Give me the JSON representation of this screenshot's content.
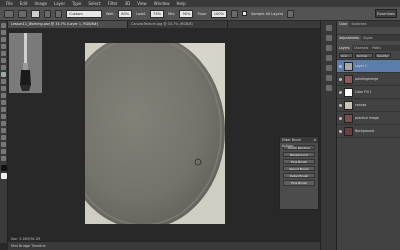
{
  "menubar": {
    "items": [
      "File",
      "Edit",
      "Image",
      "Layer",
      "Type",
      "Select",
      "Filter",
      "3D",
      "View",
      "Window",
      "Help"
    ]
  },
  "options": {
    "mode_value": "Custom",
    "wet_value": "80%",
    "load_value": "75%",
    "mix_value": "90%",
    "flow_value": "100%",
    "sample_label": "Sample All Layers"
  },
  "workspace_label": "Essentials",
  "tabs": [
    {
      "label": "Lesson11_Working.psd @ 33.7% (Layer 1, RGB/8#)",
      "active": true
    },
    {
      "label": "CanvasTexture.jpg @ 33.7% (RGB/8)",
      "active": false
    }
  ],
  "doc_info": "Doc: 5.28M/36.1M",
  "status": "Mini Bridge   Timeline",
  "actions_panel": {
    "title": "Mixer Brush Actions",
    "rows": [
      "Photo Painting",
      "Background",
      "Fine Brush",
      "Round Brush",
      "Detail Brush",
      "Fine Brush"
    ]
  },
  "panels": {
    "top_tabs": [
      "Color",
      "Swatches"
    ],
    "adj_tabs": [
      "Adjustments",
      "Styles"
    ],
    "layer_tabs": [
      "Layers",
      "Channels",
      "Paths"
    ],
    "kind_label": "Kind",
    "blend_label": "Normal",
    "opacity_label": "Opacity:",
    "layers": [
      {
        "name": "Layer 1",
        "active": true,
        "thumb": "#a8a8a8"
      },
      {
        "name": "paintingmerge",
        "active": false,
        "thumb": "#8a5c5c"
      },
      {
        "name": "Color Fill 1",
        "active": false,
        "thumb": "#ffffff"
      },
      {
        "name": "canvas",
        "active": false,
        "thumb": "#c8c4b4"
      },
      {
        "name": "practice image",
        "active": false,
        "thumb": "#7a4e4e"
      },
      {
        "name": "Background",
        "active": false,
        "thumb": "#6a3e3e"
      }
    ]
  },
  "colors": {
    "accent": "#5b7ea8",
    "canvas_light": "#d6d4c8",
    "canvas_dark": "#6a6a62"
  }
}
